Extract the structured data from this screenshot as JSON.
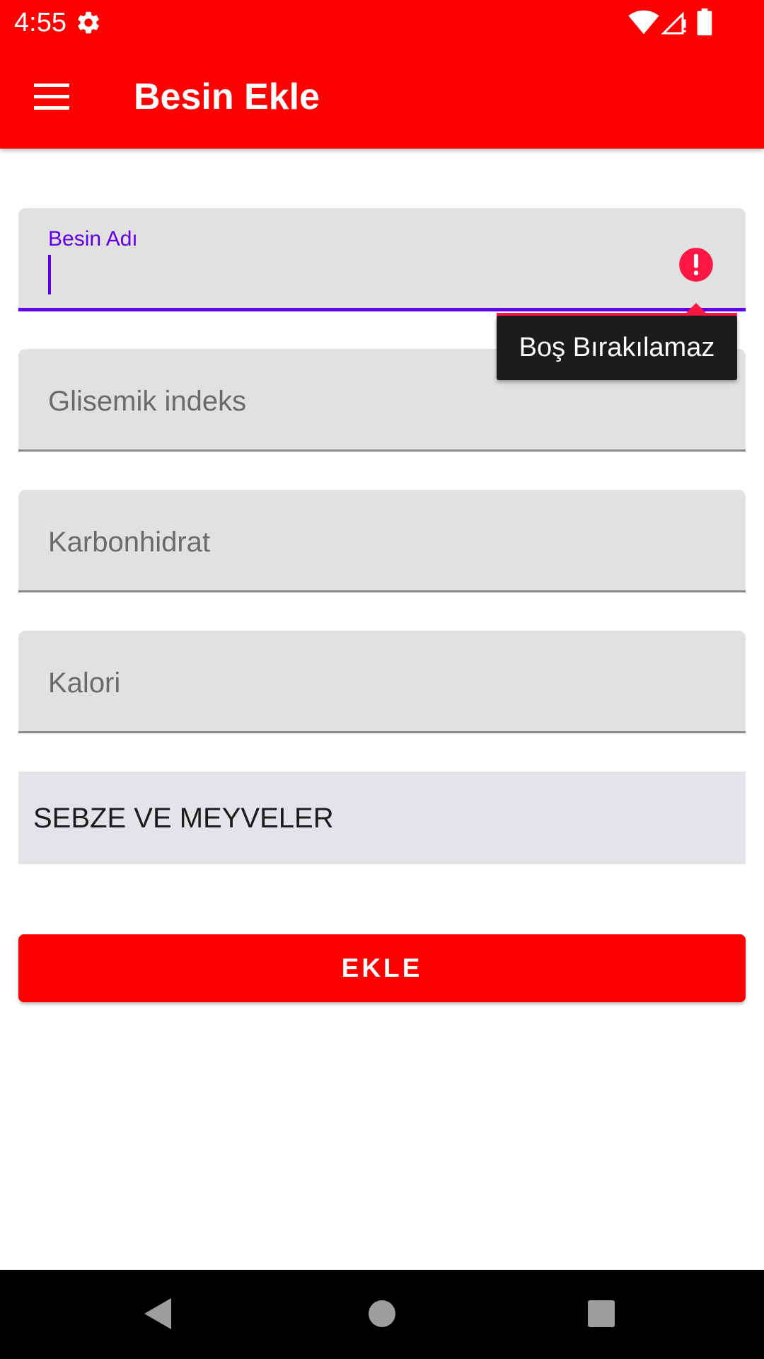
{
  "status_bar": {
    "time": "4:55",
    "icons": [
      "gear-icon",
      "wifi-icon",
      "signal-icon",
      "battery-icon"
    ]
  },
  "app_bar": {
    "title": "Besin Ekle",
    "menu_icon": "hamburger-menu-icon"
  },
  "form": {
    "fields": [
      {
        "label": "Besin Adı",
        "value": "",
        "focused": true,
        "error": true
      },
      {
        "placeholder": "Glisemik indeks",
        "value": ""
      },
      {
        "placeholder": "Karbonhidrat",
        "value": ""
      },
      {
        "placeholder": "Kalori",
        "value": ""
      }
    ],
    "error_message": "Boş Bırakılamaz",
    "category_selected": "SEBZE VE MEYVELER",
    "submit_label": "EKLE"
  },
  "nav_bar": {
    "icons": [
      "back-icon",
      "home-icon",
      "recents-icon"
    ]
  },
  "colors": {
    "primary": "#ff0000",
    "accent": "#6200ee",
    "error": "#ff1744",
    "field_background": "#e1e1e1",
    "tooltip_background": "#1c1c1c"
  }
}
